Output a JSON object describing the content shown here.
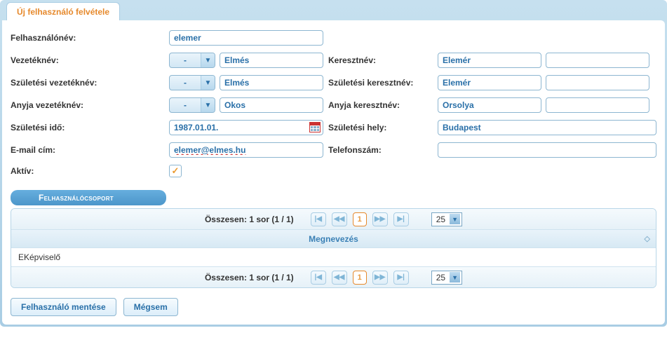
{
  "tab": {
    "title": "Új felhasználó felvétele"
  },
  "labels": {
    "username": "Felhasználónév:",
    "surname": "Vezetéknév:",
    "firstname": "Keresztnév:",
    "birth_surname": "Születési vezetéknév:",
    "birth_firstname": "Születési keresztnév:",
    "mother_surname": "Anyja vezetéknév:",
    "mother_firstname": "Anyja keresztnév:",
    "birth_date": "Születési idő:",
    "birth_place": "Születési hely:",
    "email": "E-mail cím:",
    "phone": "Telefonszám:",
    "active": "Aktív:"
  },
  "values": {
    "username": "elemer",
    "prefix_surname": "-",
    "surname": "Elmés",
    "firstname1": "Elemér",
    "firstname2": "",
    "prefix_birth_surname": "-",
    "birth_surname": "Elmés",
    "birth_firstname1": "Elemér",
    "birth_firstname2": "",
    "prefix_mother_surname": "-",
    "mother_surname": "Okos",
    "mother_firstname1": "Orsolya",
    "mother_firstname2": "",
    "birth_date": "1987.01.01.",
    "birth_place": "Budapest",
    "email": "elemer@elmes.hu",
    "phone": "",
    "active_checked": "✓"
  },
  "section": {
    "title": "Felhasználócsoport"
  },
  "pager": {
    "summary": "Összesen: 1 sor (1 / 1)",
    "page": "1",
    "page_size": "25"
  },
  "table": {
    "header": "Megnevezés",
    "rows": [
      "EKépviselő"
    ]
  },
  "buttons": {
    "save": "Felhasználó mentése",
    "cancel": "Mégsem"
  }
}
